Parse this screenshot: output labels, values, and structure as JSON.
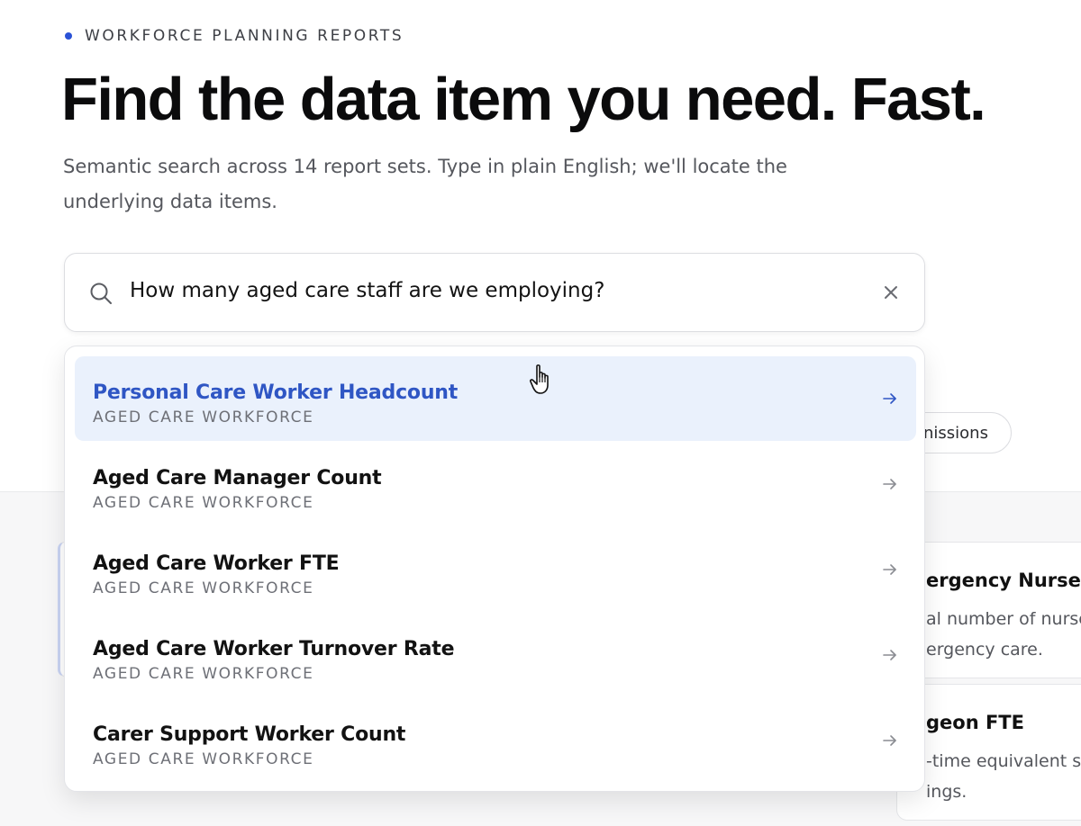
{
  "header": {
    "eyebrow": "WORKFORCE PLANNING REPORTS",
    "title": "Find the data item you need. Fast.",
    "subtitle_line1": "Semantic search across 14 report sets. Type in plain English; we'll locate the",
    "subtitle_line2": "underlying data items."
  },
  "search": {
    "query": "How many aged care staff are we employing?",
    "icon": "search-icon",
    "clear_icon": "close-icon"
  },
  "results": [
    {
      "title": "Personal Care Worker Headcount",
      "category": "AGED CARE WORKFORCE",
      "active": true
    },
    {
      "title": "Aged Care Manager Count",
      "category": "AGED CARE WORKFORCE",
      "active": false
    },
    {
      "title": "Aged Care Worker FTE",
      "category": "AGED CARE WORKFORCE",
      "active": false
    },
    {
      "title": "Aged Care Worker Turnover Rate",
      "category": "AGED CARE WORKFORCE",
      "active": false
    },
    {
      "title": "Carer Support Worker Count",
      "category": "AGED CARE WORKFORCE",
      "active": false
    }
  ],
  "background": {
    "chip_label": "nissions",
    "card1": {
      "title": "ergency Nurse F",
      "desc_line1": "al number of nurse",
      "desc_line2": "ergency care."
    },
    "card2": {
      "title": "geon FTE",
      "desc_line1": "-time equivalent s",
      "desc_line2": "ings."
    }
  },
  "colors": {
    "accent": "#2a52d6",
    "active_row_bg": "#eaf1fc",
    "active_title": "#2f56c4"
  }
}
